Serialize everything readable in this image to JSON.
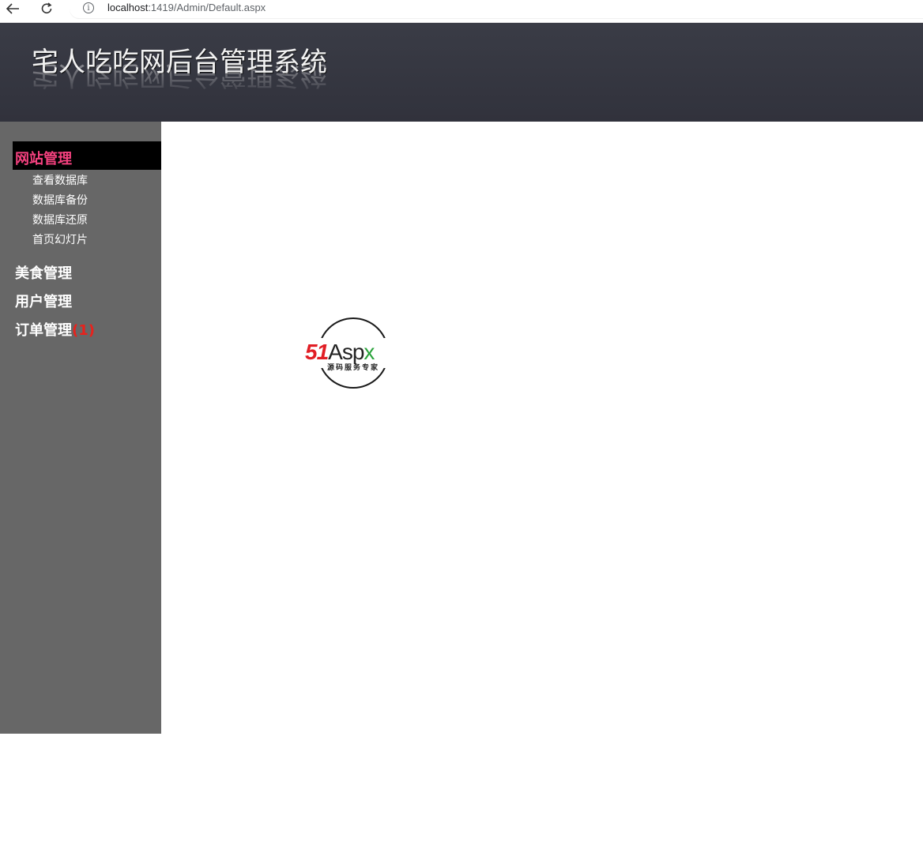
{
  "browser": {
    "url_host": "localhost",
    "url_rest": ":1419/Admin/Default.aspx"
  },
  "header": {
    "title": "宅人吃吃网后台管理系统"
  },
  "sidebar": {
    "groups": [
      {
        "label": "网站管理",
        "active": true,
        "items": [
          "查看数据库",
          "数据库备份",
          "数据库还原",
          "首页幻灯片"
        ]
      },
      {
        "label": "美食管理"
      },
      {
        "label": "用户管理"
      },
      {
        "label": "订单管理",
        "badge": "(1)"
      }
    ]
  },
  "logo": {
    "text_51": "51",
    "text_asp": "Asp",
    "text_x": "x",
    "subtitle": "源码服务专家"
  },
  "colors": {
    "header_bg": "#33343e",
    "sidebar_bg": "#676767",
    "active_menu_text": "#f5417f",
    "badge_red": "#e8221c"
  }
}
